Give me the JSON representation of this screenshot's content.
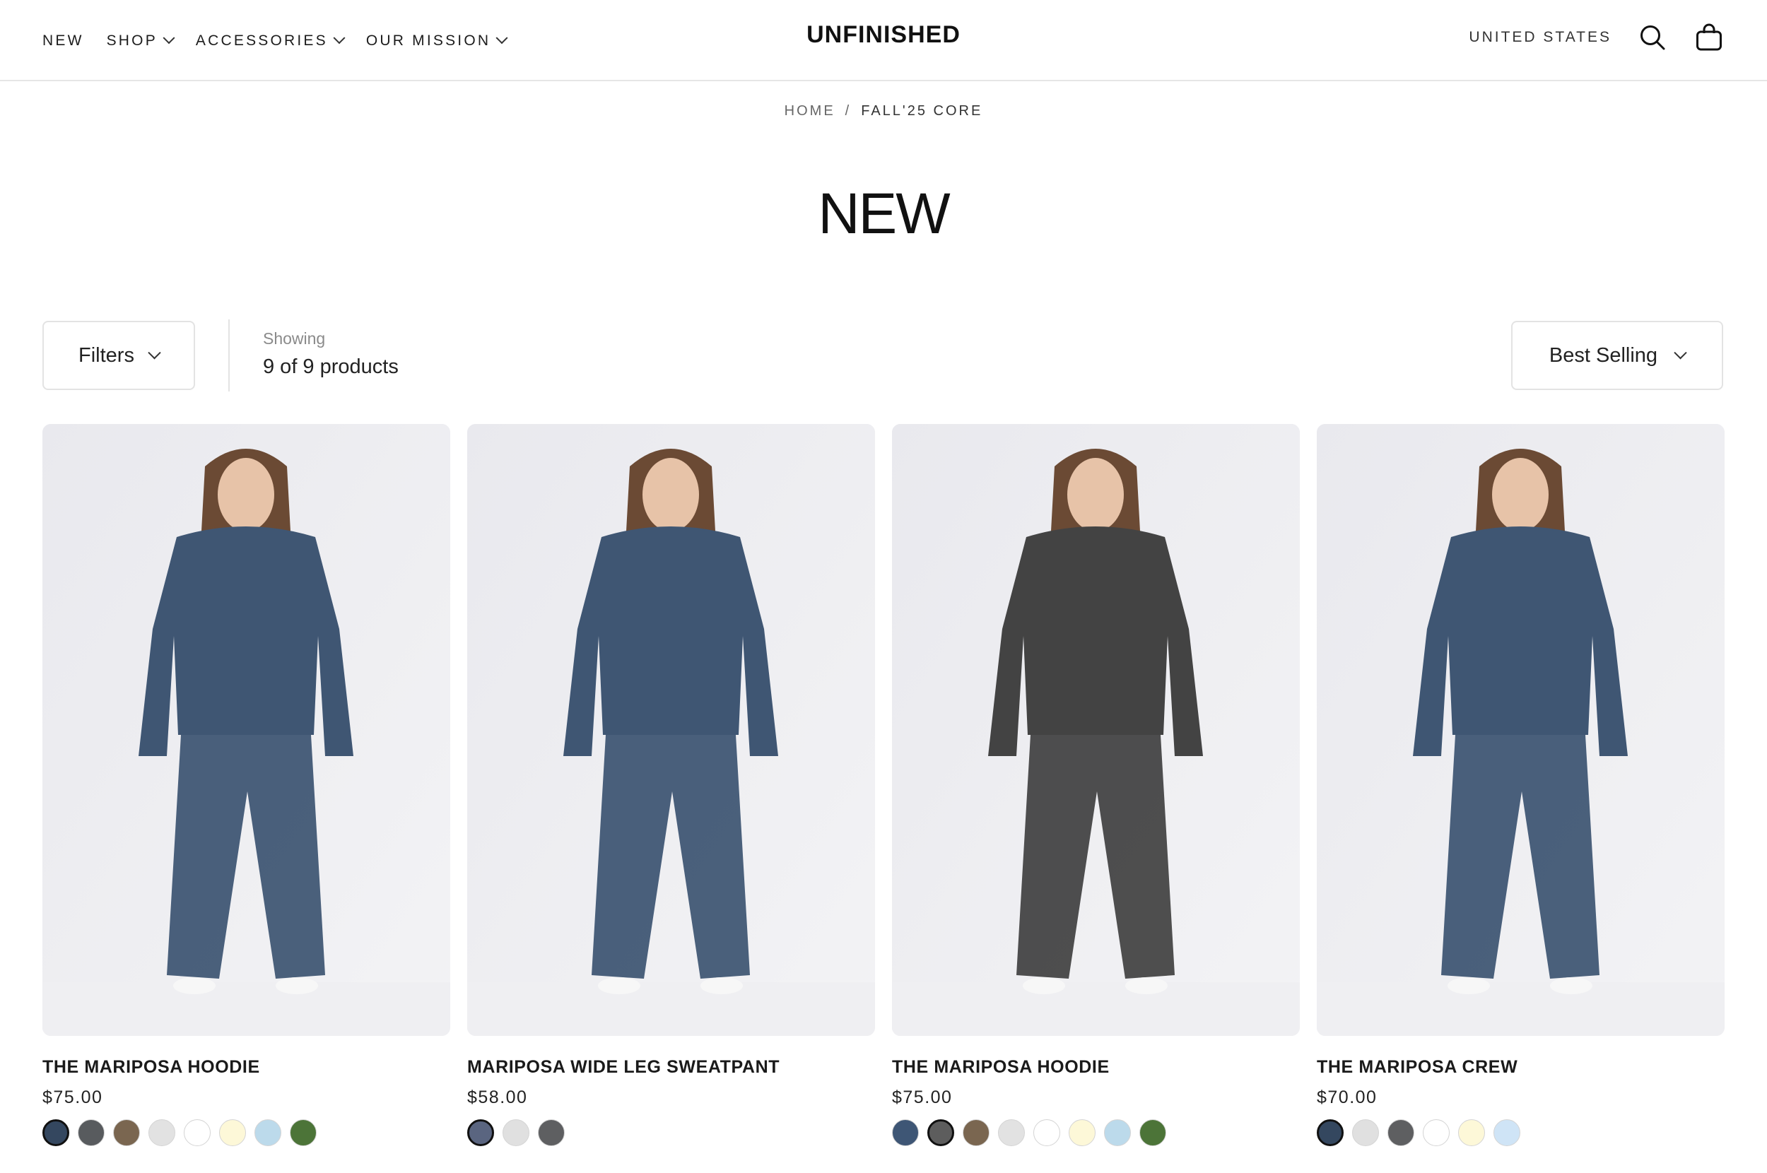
{
  "header": {
    "nav": [
      {
        "label": "NEW"
      },
      {
        "label": "SHOP"
      },
      {
        "label": "ACCESSORIES"
      },
      {
        "label": "OUR MISSION"
      }
    ],
    "logo": "UNFINISHED",
    "country": "UNITED STATES",
    "icons": {
      "search": "search-icon",
      "cart": "shopping-bag-icon"
    }
  },
  "breadcrumb": {
    "home": "HOME",
    "separator": "/",
    "current": "FALL'25 CORE"
  },
  "page": {
    "title": "NEW"
  },
  "toolbar": {
    "filters_label": "Filters",
    "showing_label": "Showing",
    "showing_count": "9 of 9 products",
    "sort_label": "Best Selling"
  },
  "products": [
    {
      "name": "THE MARIPOSA HOODIE",
      "price": "$75.00",
      "garment_color": "#3f5673",
      "swatches": [
        "#34475f",
        "#585b5e",
        "#7a6650",
        "#e2e2e2",
        "#ffffff",
        "#fdf8d8",
        "#bcdaeb",
        "#4c7438"
      ],
      "selected_swatch": 0
    },
    {
      "name": "MARIPOSA WIDE LEG SWEATPANT",
      "price": "$58.00",
      "garment_color": "#3f5673",
      "swatches": [
        "#5a6580",
        "#e0e0e0",
        "#5e5f61"
      ],
      "selected_swatch": 0
    },
    {
      "name": "THE MARIPOSA HOODIE",
      "price": "$75.00",
      "garment_color": "#434343",
      "swatches": [
        "#3e5675",
        "#5d5d5d",
        "#7a6650",
        "#e2e2e2",
        "#ffffff",
        "#fdf8d8",
        "#bcdaeb",
        "#4c7438"
      ],
      "selected_swatch": 1
    },
    {
      "name": "THE MARIPOSA CREW",
      "price": "$70.00",
      "garment_color": "#3f5673",
      "swatches": [
        "#34475f",
        "#e0e0e0",
        "#5e5f61",
        "#ffffff",
        "#fdf8d8",
        "#cfe4f6"
      ],
      "selected_swatch": 0
    }
  ]
}
